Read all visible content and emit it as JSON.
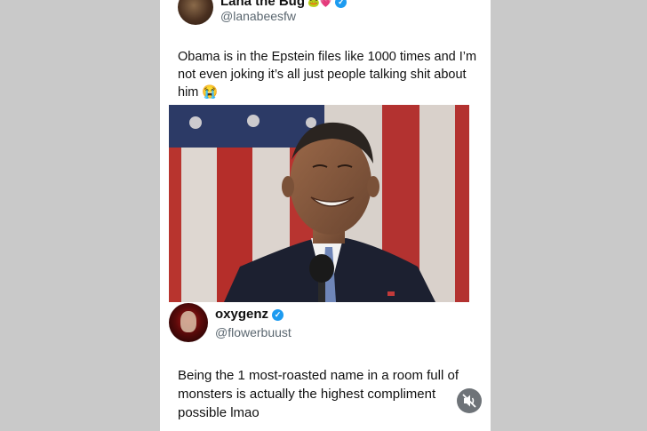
{
  "post": {
    "author_name": "Lana the Bug",
    "author_emojis": "🐸💗",
    "author_handle": "@lanabeesfw",
    "text": "Obama is in the Epstein files like 1000 times and I’m not even joking it’s all just people talking shit about him 😭"
  },
  "reply": {
    "author_name": "oxygenz",
    "author_handle": "@flowerbuust",
    "text": "Being the 1 most-roasted name in a room full of monsters is actually the highest compliment possible lmao"
  },
  "icons": {
    "verified": "verified-badge-icon",
    "mute": "speaker-muted-icon"
  },
  "colors": {
    "verified_blue": "#1d9bf0",
    "background_gray": "#c9c9c9",
    "card_white": "#ffffff",
    "handle_gray": "#5b6770"
  }
}
